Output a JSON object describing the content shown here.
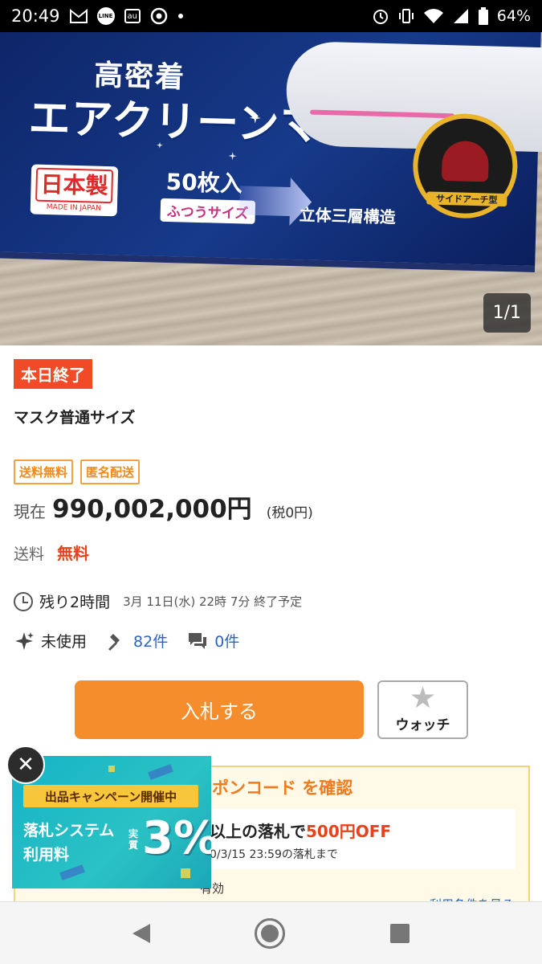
{
  "status_bar": {
    "time": "20:49",
    "line_label": "LINE",
    "au_label": "au",
    "battery": "64%"
  },
  "photo": {
    "box_text_line1": "高密着",
    "box_text_line2": "エアクリーンマスク",
    "made_in_label": "日本製",
    "made_in_sub": "MADE IN JAPAN",
    "count_label": "50枚入",
    "size_label": "ふつうサイズ",
    "structure_label": "立体三層構造",
    "badge_label": "サイドアーチ型",
    "counter": "1/1"
  },
  "listing": {
    "ending_badge": "本日終了",
    "title": "マスク普通サイズ",
    "tags": [
      "送料無料",
      "匿名配送"
    ],
    "price_label": "現在",
    "price": "990,002,000円",
    "tax": "(税0円)",
    "shipping_label": "送料",
    "shipping_value": "無料",
    "remaining": "残り2時間",
    "end_date": "3月 11日(水) 22時 7分 終了予定",
    "condition": "未使用",
    "bid_count": "82件",
    "comment_count": "0件",
    "bid_button": "入札する",
    "watch_button": "ウォッチ"
  },
  "coupon": {
    "link": "ポンコード を確認",
    "condition_prefix": "以上の落札で",
    "condition_off": "500円OFF",
    "deadline": "0/3/15 23:59の落札まで",
    "valid": "有効",
    "terms": "利用条件を見る"
  },
  "campaign": {
    "ribbon": "出品キャンペーン開催中",
    "line1": "落札システム",
    "line2": "利用料",
    "jissitsu": "実質",
    "percent": "3%",
    "close": "✕"
  },
  "colors": {
    "accent_orange": "#f58d2c",
    "ending_red": "#f04b26",
    "link_blue": "#2a63c4",
    "campaign_teal": "#17b3c7"
  }
}
